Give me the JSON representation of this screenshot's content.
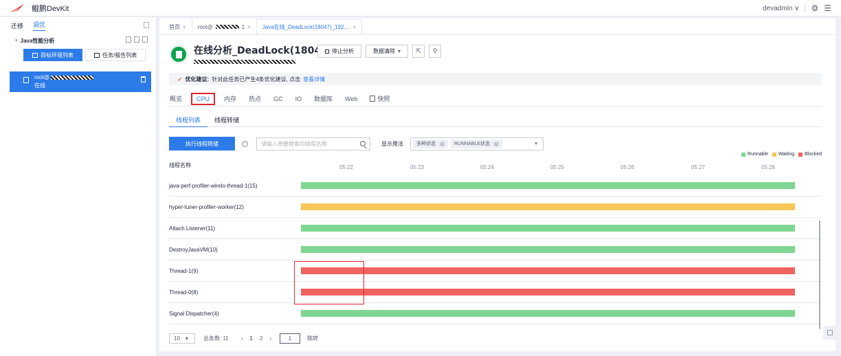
{
  "app": {
    "name": "鲲鹏DevKit",
    "user": "devadmin",
    "user_caret": "∨",
    "settings_icon": "⚙",
    "menu_icon": "☰"
  },
  "sidebar": {
    "tabs": [
      {
        "label": "迁移"
      },
      {
        "label": "调优"
      }
    ],
    "group_caret": "▾",
    "group_label": "Java性能分析",
    "buttons": [
      {
        "label": "目标环境列表"
      },
      {
        "label": "任务/报告列表"
      }
    ],
    "node": {
      "host_prefix": "root@",
      "status": "在线"
    }
  },
  "page_tabs": [
    {
      "label": "首页"
    },
    {
      "label_prefix": "root@",
      "label_suffix": "1"
    },
    {
      "label": "Java在线_DeadLock(18047)_192...."
    }
  ],
  "close_glyph": "×",
  "header": {
    "title": "在线分析_DeadLock(18047)",
    "stop_button": "停止分析",
    "clear_button": "数据清除",
    "clear_caret": "▾",
    "export_icon": "⇱",
    "settings_icon": "⚲"
  },
  "advice": {
    "label": "优化建议:",
    "text": "针对此任务已产生4条优化建议, 点击",
    "link": "查看详情"
  },
  "main_tabs": [
    {
      "label": "概览"
    },
    {
      "label": "CPU"
    },
    {
      "label": "内存"
    },
    {
      "label": "热点"
    },
    {
      "label": "GC"
    },
    {
      "label": "IO"
    },
    {
      "label": "数据库"
    },
    {
      "label": "Web"
    },
    {
      "label": "快照"
    }
  ],
  "sub_tabs": [
    {
      "label": "线程列表"
    },
    {
      "label": "线程转储"
    }
  ],
  "toolbar": {
    "dump_button": "执行线程转储",
    "info_glyph": "i",
    "search_placeholder": "请输入想要搜索的线程名称",
    "display_label": "显示用法",
    "chips": [
      {
        "label": "多种状态"
      },
      {
        "label": "RUNNABLE状态"
      }
    ],
    "chip_close": "×",
    "select_caret": "▾"
  },
  "legend": [
    {
      "label": "Runnable",
      "color": "#7fd693"
    },
    {
      "label": "Waiting",
      "color": "#f7c75a"
    },
    {
      "label": "Blocked",
      "color": "#ef6461"
    }
  ],
  "chart_data": {
    "type": "timeline",
    "x_label": "线程名称",
    "time_ticks": [
      "05:22",
      "05:23",
      "05:24",
      "05:25",
      "05:26",
      "05:27",
      "05:28"
    ],
    "threads": [
      {
        "name": "java-perf-profiler-wirelo-thread-1(15)",
        "state": "Runnable",
        "color": "#7fd693"
      },
      {
        "name": "hyper-tuner-profiler-worker(12)",
        "state": "Waiting",
        "color": "#f7c75a"
      },
      {
        "name": "Attach Listener(11)",
        "state": "Runnable",
        "color": "#7fd693"
      },
      {
        "name": "DestroyJavaVM(10)",
        "state": "Runnable",
        "color": "#7fd693"
      },
      {
        "name": "Thread-1(9)",
        "state": "Blocked",
        "color": "#ef6461"
      },
      {
        "name": "Thread-0(8)",
        "state": "Blocked",
        "color": "#ef6461"
      },
      {
        "name": "Signal Dispatcher(4)",
        "state": "Runnable",
        "color": "#7fd693"
      }
    ]
  },
  "pager": {
    "page_size": "10",
    "size_caret": "▾",
    "total": "总条数: 11",
    "prev": "‹",
    "pages": [
      "1",
      "2"
    ],
    "next": "›",
    "jump_value": "1",
    "jump_label": "跳转"
  }
}
